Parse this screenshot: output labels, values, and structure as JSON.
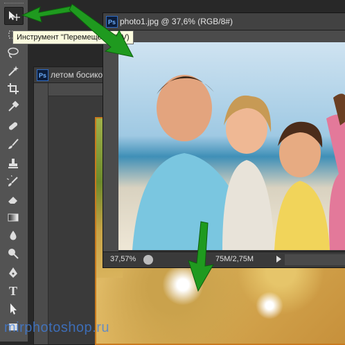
{
  "toolbar": {
    "tools": [
      {
        "name": "move-tool",
        "icon": "move-icon"
      },
      {
        "name": "marquee-tool",
        "icon": "marquee-icon"
      },
      {
        "name": "lasso-tool",
        "icon": "lasso-icon"
      },
      {
        "name": "magic-wand-tool",
        "icon": "magic-wand-icon"
      },
      {
        "name": "crop-tool",
        "icon": "crop-icon"
      },
      {
        "name": "eyedropper-tool",
        "icon": "eyedropper-icon"
      },
      {
        "name": "healing-brush-tool",
        "icon": "bandage-icon"
      },
      {
        "name": "brush-tool",
        "icon": "brush-icon"
      },
      {
        "name": "clone-stamp-tool",
        "icon": "stamp-icon"
      },
      {
        "name": "history-brush-tool",
        "icon": "history-brush-icon"
      },
      {
        "name": "eraser-tool",
        "icon": "eraser-icon"
      },
      {
        "name": "gradient-tool",
        "icon": "gradient-icon"
      },
      {
        "name": "blur-tool",
        "icon": "drop-icon"
      },
      {
        "name": "dodge-tool",
        "icon": "dodge-icon"
      },
      {
        "name": "pen-tool",
        "icon": "pen-icon"
      },
      {
        "name": "type-tool",
        "icon": "type-icon"
      },
      {
        "name": "path-selection-tool",
        "icon": "arrow-icon"
      },
      {
        "name": "shape-tool",
        "icon": "rectangle-icon"
      }
    ]
  },
  "tooltip": {
    "text": "Инструмент \"Перемещение\" (V)"
  },
  "doc_front": {
    "badge": "Ps",
    "title": "photo1.jpg @ 37,6% (RGB/8#)",
    "status_zoom": "37,57%",
    "status_doc": "75M/2,75M"
  },
  "doc_back": {
    "badge": "Ps",
    "title": "летом босико"
  },
  "watermark": {
    "text": "mirphotoshop.ru"
  },
  "colors": {
    "accent_arrow": "#1f9a1f",
    "frame": "#c97a1f",
    "toolbar": "#535353"
  }
}
